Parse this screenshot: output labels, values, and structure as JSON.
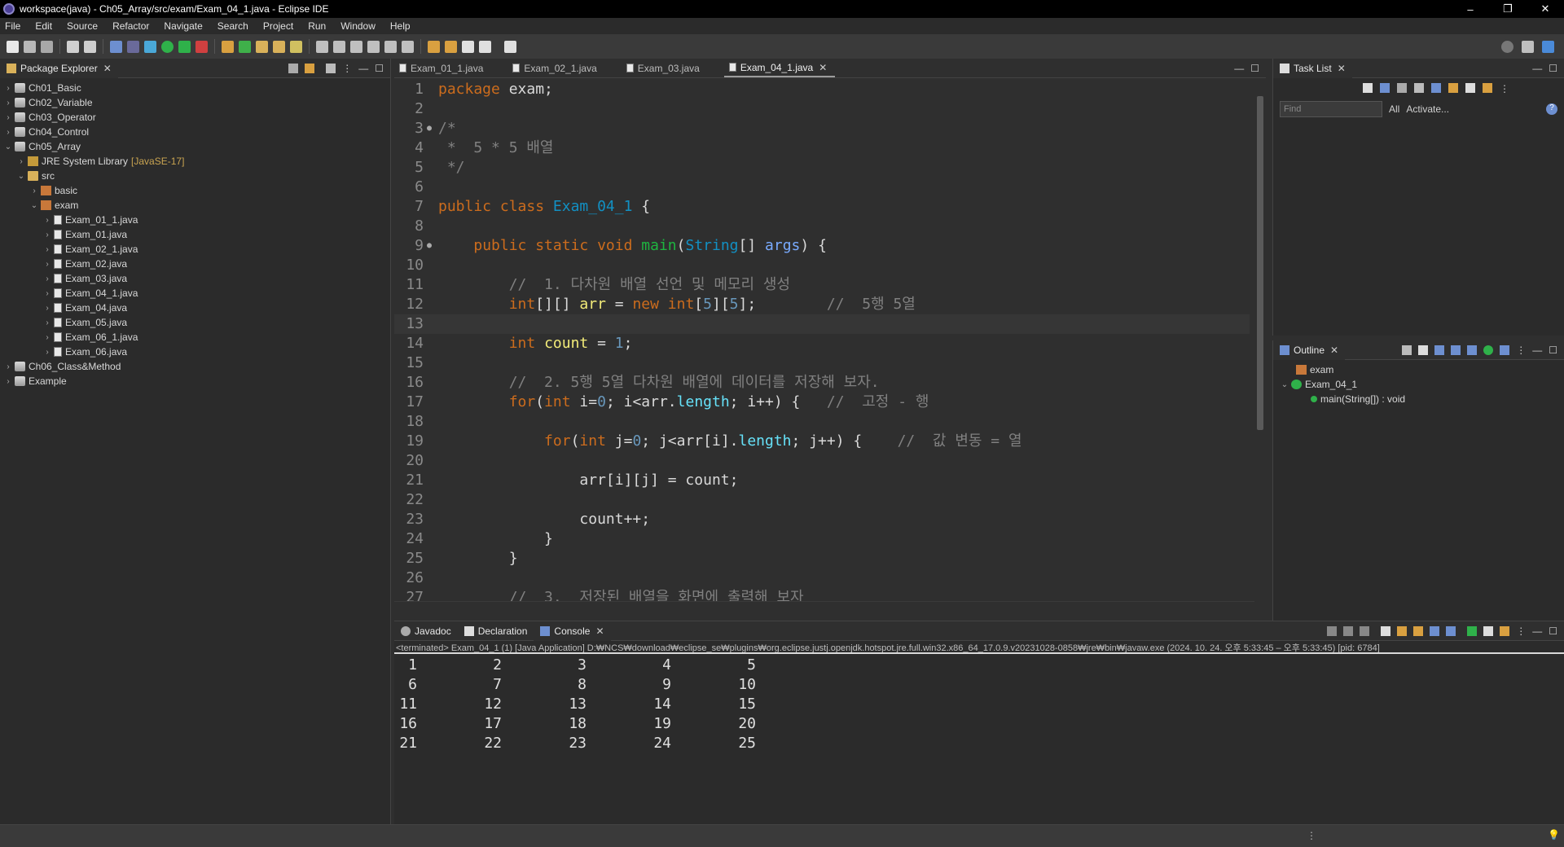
{
  "window": {
    "title": "workspace(java) - Ch05_Array/src/exam/Exam_04_1.java - Eclipse IDE",
    "minimize": "–",
    "maximize": "❐",
    "close": "✕"
  },
  "menu": [
    "File",
    "Edit",
    "Source",
    "Refactor",
    "Navigate",
    "Search",
    "Project",
    "Run",
    "Window",
    "Help"
  ],
  "package_explorer": {
    "title": "Package Explorer",
    "items": [
      {
        "label": "Ch01_Basic",
        "suffix": ""
      },
      {
        "label": "Ch02_Variable",
        "suffix": ""
      },
      {
        "label": "Ch03_Operator",
        "suffix": ""
      },
      {
        "label": "Ch04_Control",
        "suffix": ""
      },
      {
        "label": "Ch05_Array",
        "suffix": ""
      },
      {
        "label": "JRE System Library",
        "suffix": "[JavaSE-17]"
      },
      {
        "label": "src",
        "suffix": ""
      },
      {
        "label": "basic",
        "suffix": ""
      },
      {
        "label": "exam",
        "suffix": ""
      },
      {
        "label": "Exam_01_1.java",
        "suffix": ""
      },
      {
        "label": "Exam_01.java",
        "suffix": ""
      },
      {
        "label": "Exam_02_1.java",
        "suffix": ""
      },
      {
        "label": "Exam_02.java",
        "suffix": ""
      },
      {
        "label": "Exam_03.java",
        "suffix": ""
      },
      {
        "label": "Exam_04_1.java",
        "suffix": ""
      },
      {
        "label": "Exam_04.java",
        "suffix": ""
      },
      {
        "label": "Exam_05.java",
        "suffix": ""
      },
      {
        "label": "Exam_06_1.java",
        "suffix": ""
      },
      {
        "label": "Exam_06.java",
        "suffix": ""
      },
      {
        "label": "Ch06_Class&Method",
        "suffix": ""
      },
      {
        "label": "Example",
        "suffix": ""
      }
    ]
  },
  "editor": {
    "tabs": [
      {
        "label": "Exam_01_1.java"
      },
      {
        "label": "Exam_02_1.java"
      },
      {
        "label": "Exam_03.java"
      },
      {
        "label": "Exam_04_1.java"
      }
    ],
    "active_tab": "Exam_04_1.java",
    "line_numbers": [
      "1",
      "2",
      "3",
      "4",
      "5",
      "6",
      "7",
      "8",
      "9",
      "10",
      "11",
      "12",
      "13",
      "14",
      "15",
      "16",
      "17",
      "18",
      "19",
      "20",
      "21",
      "22",
      "23",
      "24",
      "25",
      "26",
      "27"
    ]
  },
  "task_list": {
    "title": "Task List",
    "find_placeholder": "Find",
    "all_label": "All",
    "activate_label": "Activate..."
  },
  "outline": {
    "title": "Outline",
    "package": "exam",
    "class": "Exam_04_1",
    "method": "main(String[]) : void"
  },
  "console": {
    "tabs": [
      "Javadoc",
      "Declaration",
      "Console"
    ],
    "terminated": "<terminated> Exam_04_1 (1) [Java Application] D:₩NCS₩download₩eclipse_se₩plugins₩org.eclipse.justj.openjdk.hotspot.jre.full.win32.x86_64_17.0.9.v20231028-0858₩jre₩bin₩javaw.exe  (2024. 10. 24. 오후 5:33:45 – 오후 5:33:45) [pid: 6784]",
    "output": [
      [
        "1",
        "2",
        "3",
        "4",
        "5"
      ],
      [
        "6",
        "7",
        "8",
        "9",
        "10"
      ],
      [
        "11",
        "12",
        "13",
        "14",
        "15"
      ],
      [
        "16",
        "17",
        "18",
        "19",
        "20"
      ],
      [
        "21",
        "22",
        "23",
        "24",
        "25"
      ]
    ]
  },
  "colors": {
    "keyword": "#cc6c1d",
    "comment": "#808080",
    "class": "#1290c3",
    "method": "#1eb540",
    "variable": "#f3ec79",
    "number": "#6897bb",
    "field": "#66e1f8",
    "param": "#79abff"
  }
}
